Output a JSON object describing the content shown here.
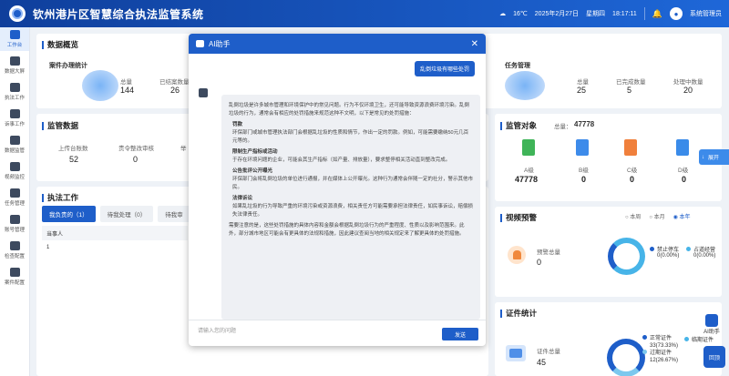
{
  "header": {
    "title": "钦州港片区智慧综合执法监管系统",
    "temperature": "16℃",
    "date": "2025年2月27日",
    "weekday": "星期四",
    "time": "18:17:11",
    "username": "系统管理员"
  },
  "sidebar": {
    "items": [
      {
        "label": "工作台"
      },
      {
        "label": "数据大屏"
      },
      {
        "label": "执法工作"
      },
      {
        "label": "诉事工作"
      },
      {
        "label": "数据监管"
      },
      {
        "label": "视频监控"
      },
      {
        "label": "任务管理"
      },
      {
        "label": "账号管理"
      },
      {
        "label": "检查配置"
      },
      {
        "label": "案件配置"
      }
    ]
  },
  "overview": {
    "title": "数据概览",
    "case_stats": "案件办理统计",
    "total_label": "总量",
    "total": "144",
    "closed_label": "已结案数量",
    "closed": "26"
  },
  "task_mgmt": {
    "title": "任务管理",
    "total_label": "总量",
    "total": "25",
    "done_label": "已完成数量",
    "done": "5",
    "pending_label": "处理中数量",
    "pending": "20"
  },
  "supervision": {
    "title": "监管数据",
    "items": [
      {
        "label": "上传台账数",
        "value": "52"
      },
      {
        "label": "责令整改审核",
        "value": "0"
      },
      {
        "label": "举"
      }
    ]
  },
  "enforcement": {
    "title": "执法工作",
    "tabs": [
      "我负责的（1）",
      "待我处理（0）",
      "待我审"
    ],
    "col_header": "当事人",
    "row_num": "1"
  },
  "targets": {
    "title": "监管对象",
    "total_label": "总量：",
    "total": "47778",
    "cats": [
      {
        "label": "A级",
        "value": "47778",
        "color": "#3fb458"
      },
      {
        "label": "B级",
        "value": "0",
        "color": "#3d8bea"
      },
      {
        "label": "C级",
        "value": "0",
        "color": "#f0803c"
      },
      {
        "label": "D级",
        "value": "0",
        "color": "#3a8be9"
      }
    ]
  },
  "video": {
    "title": "视频预警",
    "filters": [
      "本周",
      "本月",
      "本年"
    ],
    "alarm_label": "预警总量",
    "alarm_total": "0",
    "legend": [
      {
        "label": "禁止停车",
        "value": "0(0.00%)",
        "color": "#1e5ec9"
      },
      {
        "label": "占道经营",
        "value": "0(0.00%)",
        "color": "#47b4e8"
      }
    ]
  },
  "cert": {
    "title": "证件统计",
    "total_label": "证件总量",
    "total": "45",
    "legend": [
      {
        "label": "正常证件",
        "value": "33(73.33%)",
        "color": "#1e5ec9"
      },
      {
        "label": "临期证件",
        "value": "",
        "color": "#47b4e8"
      },
      {
        "label": "过期证件",
        "value": "12(26.67%)",
        "color": "#7cc8ee"
      }
    ]
  },
  "modal": {
    "title": "AI助手",
    "question": "乱倒垃圾有哪些处罚",
    "intro": "乱倒垃圾是许多城市管理和环境保护中的常见问题。行为不仅环境卫生，还可能导致资源浪费环境污染。乱倒垃圾的行为，通常会有相应的处罚措施来规范这种不文明，以下是常见的处罚措施：",
    "points": [
      {
        "h": "罚款",
        "b": "环保部门或城市管理执法部门会根据乱垃圾的性质和情节，作出一定的罚款。例如，可能需要缴纳50元几百元等的。"
      },
      {
        "h": "限制生产指标或活动",
        "b": "于存在环境问题的企业，可能会其生产指标（如产量、排放量），要求整停相关活动直到整改完成。"
      },
      {
        "h": "公告批评公开曝光",
        "b": "环保部门会将乱倒垃圾的单位进行通报，并在媒体上公开曝光。这种行为通常会伴随一定的社分，警示其他市民。"
      },
      {
        "h": "法律诉讼",
        "b": "如果乱垃圾的行为导致严重的环境污染或资源浪费，相关责任方可能需要承担法律责任，如民事诉讼，赔偿损失法律责任。"
      }
    ],
    "outro": "需要注意的是，这些处罚措施的具体内容和金额会根据乱倒垃圾行为的严重程度、性质以及影响范围来。此外，部分城市地区可能会有更具体的法规和措施，因此建议查阅当地的相关规定来了解更具体的处罚措施。",
    "placeholder": "请输入您的问题",
    "send": "发送"
  },
  "floating": {
    "expand": "展开",
    "ai": "AI助手",
    "top": "回顶"
  }
}
